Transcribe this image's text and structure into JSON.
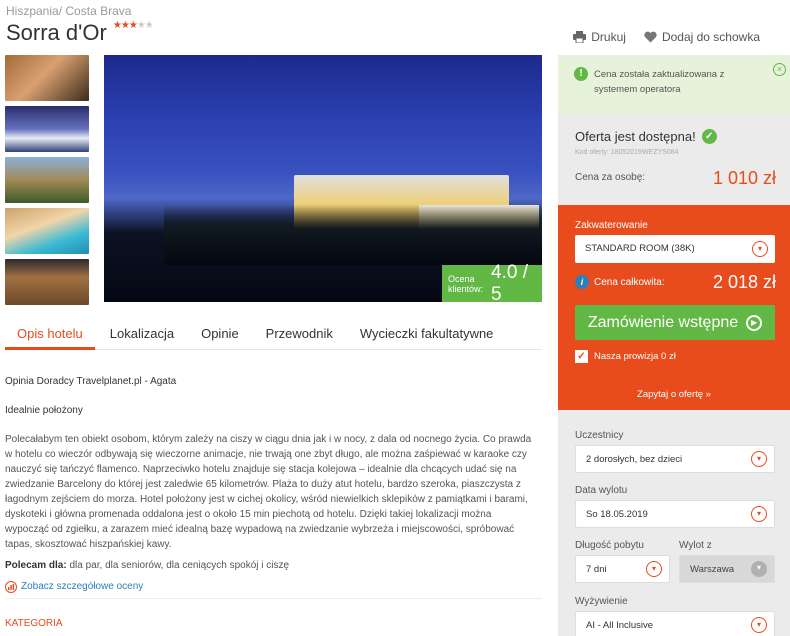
{
  "breadcrumb": {
    "country": "Hiszpania",
    "separator": "/",
    "region": "Costa Brava"
  },
  "hotel": {
    "name": "Sorra d'Or",
    "stars_on": "★★★",
    "stars_off": "★★"
  },
  "header_actions": {
    "print_label": "Drukuj",
    "favorite_label": "Dodaj do schowka"
  },
  "rating": {
    "label_line1": "Ocena",
    "label_line2": "klientów:",
    "value": "4.0 / 5"
  },
  "tabs": [
    "Opis hotelu",
    "Lokalizacja",
    "Opinie",
    "Przewodnik",
    "Wycieczki fakultatywne"
  ],
  "description": {
    "author": "Opinia Doradcy Travelplanet.pl - Agata",
    "heading": "Idealnie położony",
    "paragraph": "Polecałabym ten obiekt osobom, którym zależy na ciszy w ciągu dnia jak i w nocy, z dala od nocnego życia. Co prawda w hotelu co wieczór odbywają się wieczorne animacje, nie trwają one zbyt długo, ale można zaśpiewać w karaoke czy nauczyć się tańczyć flamenco. Naprzeciwko hotelu znajduje się stacja kolejowa – idealnie dla chcących udać się na zwiedzanie Barcelony do której jest zaledwie 65 kilometrów. Plaża to duży atut hotelu, bardzo szeroka, piaszczysta z łagodnym zejściem do morza. Hotel położony jest w cichej okolicy, wśród niewielkich sklepików z pamiątkami i barami, dyskoteki i główna promenada oddalona jest o około 15 min piechotą od hotelu. Dzięki takiej lokalizacji można wypocząć od zgiełku, a zarazem mieć idealną bazę wypadową na zwiedzanie wybrzeża i miejscowości, spróbować tapas, skosztować hiszpańskiej kawy.",
    "recommended_label": "Polecam dla:",
    "recommended_value": " dla par, dla seniorów, dla ceniących spokój i ciszę",
    "ratings_link": "Zobacz szczegółowe oceny"
  },
  "category_label": "KATEGORIA",
  "notice": {
    "text": "Cena została zaktualizowana z systemem operatora"
  },
  "offer": {
    "status": "Oferta jest dostępna!",
    "code": "Kod oferty: 18052019WEZYS084",
    "price_label": "Cena za osobę:",
    "price_value": "1 010 zł"
  },
  "booking": {
    "room_label": "Zakwaterowanie",
    "room_value": "STANDARD ROOM (38K)",
    "total_label": "Cena całkowita:",
    "total_value": "2 018 zł",
    "order_button": "Zamówienie wstępne",
    "commission_label": "Nasza prowizja 0 zł",
    "ask_link": "Zapytaj o ofertę »"
  },
  "form": {
    "participants_label": "Uczestnicy",
    "participants_value": "2 dorosłych, bez dzieci",
    "departure_label": "Data wylotu",
    "departure_value": "So 18.05.2019",
    "duration_label": "Długość pobytu",
    "duration_value": "7 dni",
    "from_label": "Wylot z",
    "from_value": "Warszawa",
    "board_label": "Wyżywienie",
    "board_value": "AI - All Inclusive"
  },
  "colors": {
    "accent": "#e84c1c",
    "success": "#62b845",
    "info": "#2c7fb8"
  }
}
